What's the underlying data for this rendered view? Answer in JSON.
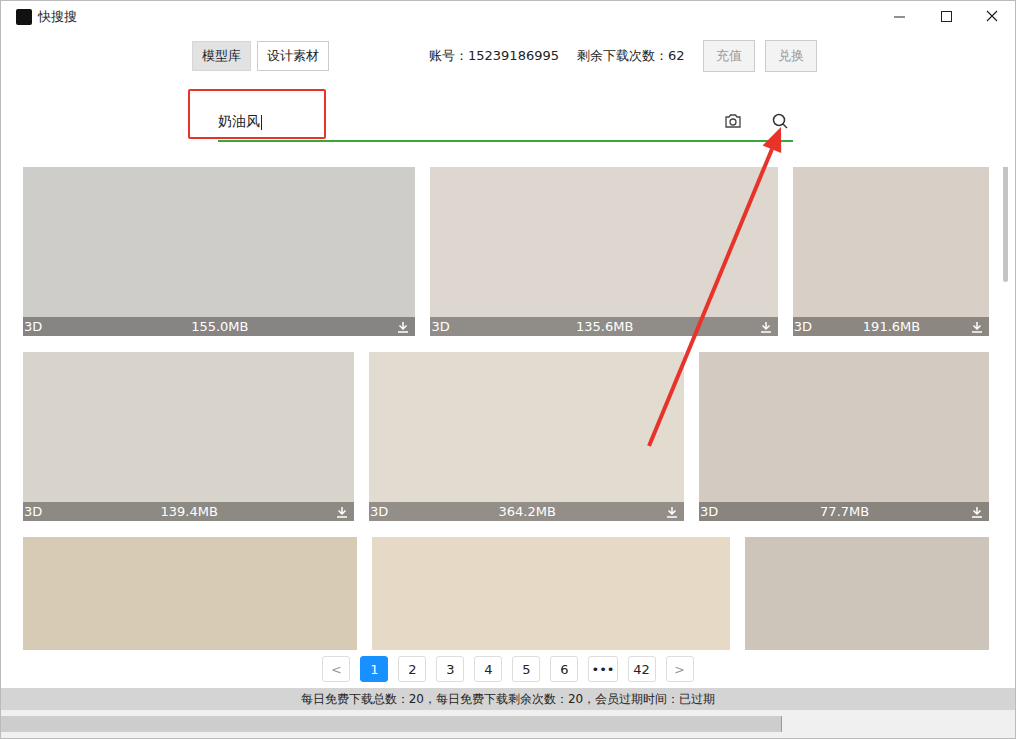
{
  "window": {
    "title": "快搜搜"
  },
  "tabs": [
    {
      "label": "模型库",
      "selected": true
    },
    {
      "label": "设计素材",
      "selected": false
    }
  ],
  "account": "账号：15239186995",
  "remaining": "剩余下载次数：62",
  "buttons": [
    {
      "label": "充值",
      "disabled": true
    },
    {
      "label": "兑换",
      "disabled": true
    }
  ],
  "search": {
    "value": "奶油风"
  },
  "grid": {
    "rows": [
      {
        "cards": [
          {
            "kind": "3D",
            "size": "155.0MB",
            "color": "#cfcdca"
          },
          {
            "kind": "3D",
            "size": "135.6MB",
            "color": "#ddd7cf"
          },
          {
            "kind": "3D",
            "size": "191.6MB",
            "color": "#d8d0c6"
          }
        ]
      },
      {
        "cards": [
          {
            "kind": "3D",
            "size": "139.4MB",
            "color": "#d9d4cb"
          },
          {
            "kind": "3D",
            "size": "364.2MB",
            "color": "#e2dbd0"
          },
          {
            "kind": "3D",
            "size": "77.7MB",
            "color": "#d3cbc2"
          }
        ]
      },
      {
        "cards": [
          {
            "color": "#d8cbb5"
          },
          {
            "color": "#e6dac6"
          },
          {
            "color": "#cdc4ba"
          }
        ]
      }
    ]
  },
  "pagination": {
    "prev": "<",
    "next": ">",
    "pages": [
      {
        "label": "1",
        "selected": true
      },
      {
        "label": "2",
        "selected": false
      },
      {
        "label": "3",
        "selected": false
      },
      {
        "label": "4",
        "selected": false
      },
      {
        "label": "5",
        "selected": false
      },
      {
        "label": "6",
        "selected": false
      },
      {
        "label": "•••",
        "selected": false
      },
      {
        "label": "42",
        "selected": false
      }
    ]
  },
  "status_bar": "每日免费下载总数：20，每日免费下载剩余次数：20，会员过期时间：已过期"
}
